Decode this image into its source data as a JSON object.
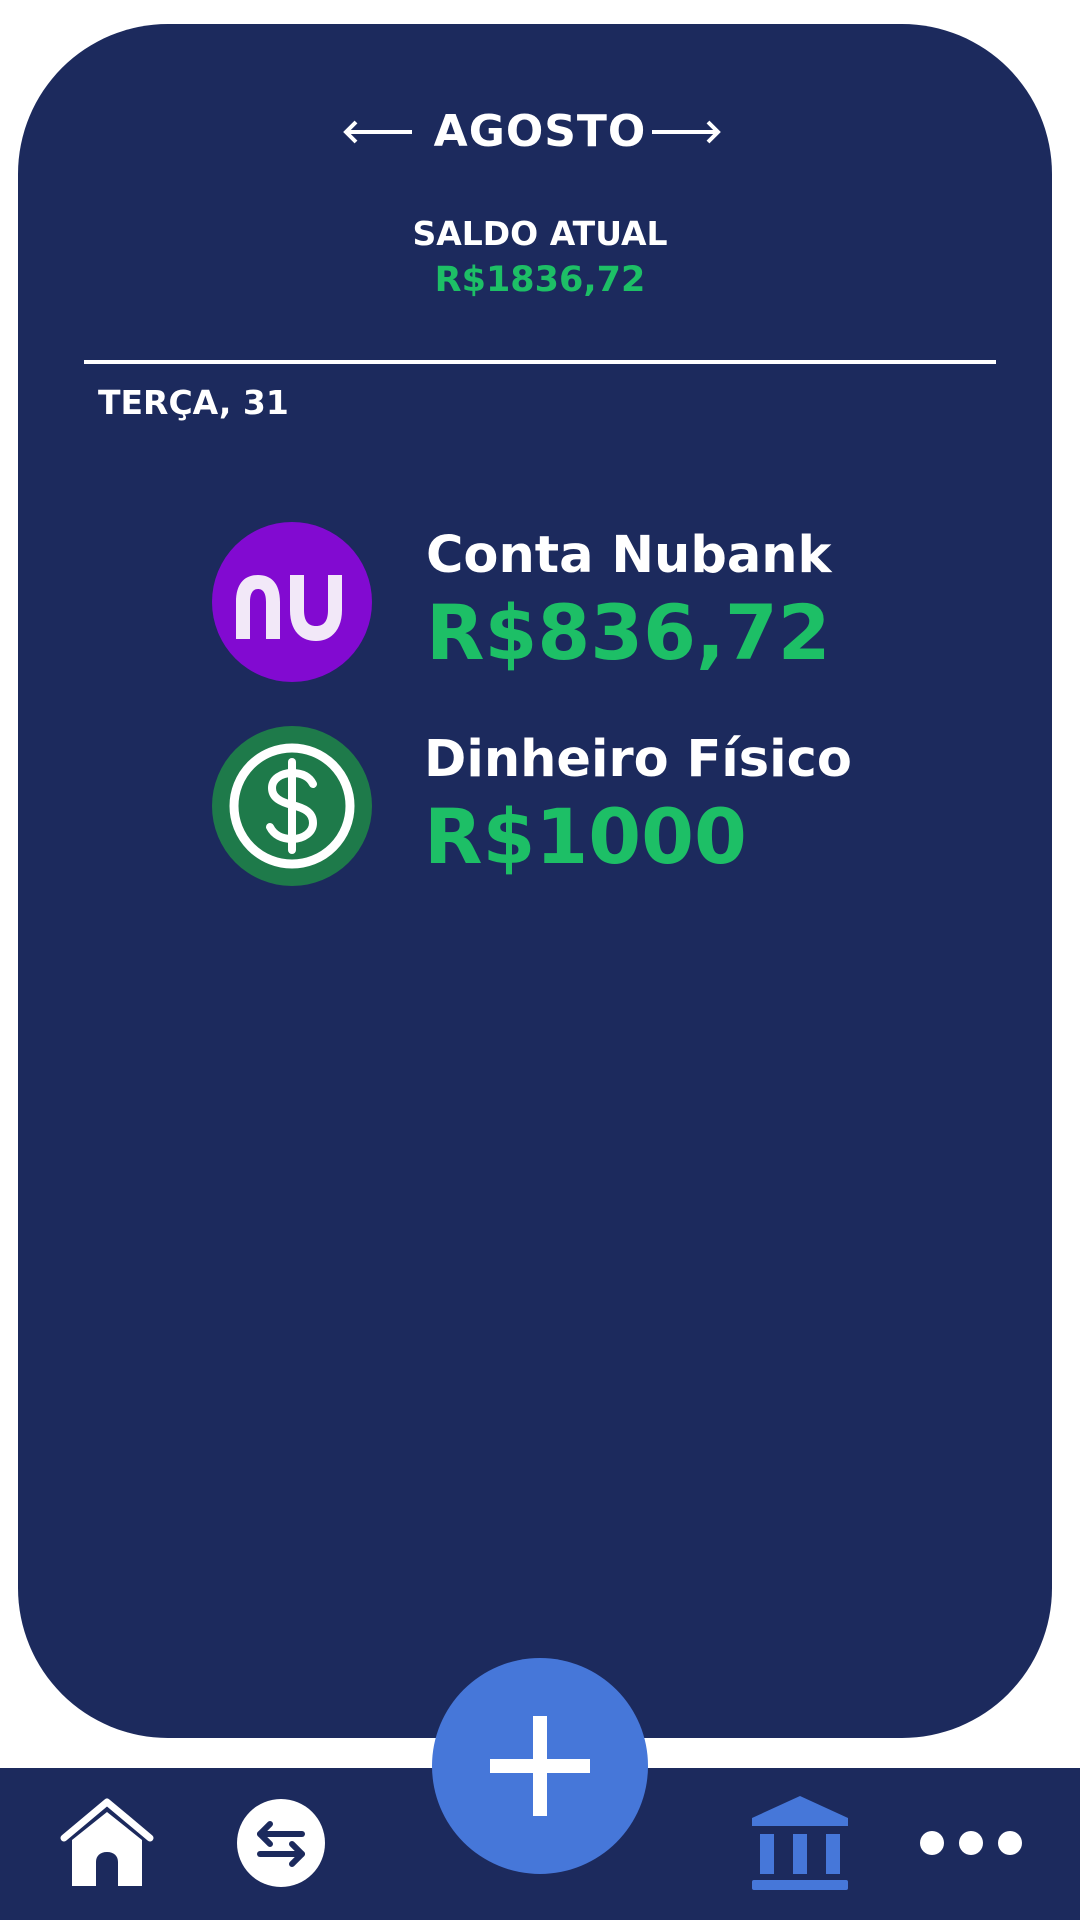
{
  "header": {
    "month": "AGOSTO",
    "prev_month_icon": "arrow-left-icon",
    "next_month_icon": "arrow-right-icon"
  },
  "summary": {
    "label": "SALDO ATUAL",
    "value": "R$1836,72",
    "value_color": "#1dbf66"
  },
  "day": {
    "label": "TERÇA, 31"
  },
  "accounts": [
    {
      "name": "Conta Nubank",
      "balance": "R$836,72",
      "icon": "nubank-logo-icon",
      "icon_color": "#820ad1"
    },
    {
      "name": "Dinheiro Físico",
      "balance": "R$1000",
      "icon": "cash-dollar-icon",
      "icon_color": "#1e7a4a"
    }
  ],
  "bottom_nav": {
    "items": [
      {
        "icon": "home-icon"
      },
      {
        "icon": "transfer-icon"
      },
      {
        "icon": "bank-icon",
        "active": true
      },
      {
        "icon": "more-icon"
      }
    ],
    "fab_icon": "plus-icon",
    "fab_color": "#4677d9"
  },
  "colors": {
    "background": "#1c2a5d",
    "accent": "#4677d9",
    "positive": "#1dbf66"
  }
}
